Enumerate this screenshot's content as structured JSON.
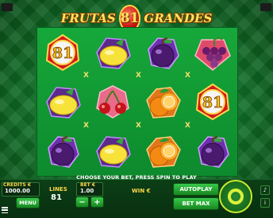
{
  "title": {
    "word_left": "FRUTAS",
    "badge": "81",
    "word_right": "GRANDES"
  },
  "reels": [
    [
      "81",
      "lemon",
      "plum"
    ],
    [
      "lemon",
      "cherries",
      "lemon"
    ],
    [
      "plum",
      "orange",
      "orange"
    ],
    [
      "grapes",
      "81",
      "plum"
    ]
  ],
  "line_marker": "X",
  "message": "CHOOSE YOUR BET, PRESS SPIN TO PLAY",
  "credit": {
    "label": "CREDITS €",
    "value": "1000.00"
  },
  "menu_label": "MENU",
  "lines": {
    "label": "LINES",
    "value": "81"
  },
  "bet": {
    "label": "BET €",
    "value": "1.00"
  },
  "win": {
    "label": "WIN €",
    "value": ""
  },
  "autoplay_label": "AUTOPLAY",
  "betmax_label": "BET MAX",
  "icons": {
    "minus": "minus-icon",
    "plus": "plus-icon",
    "spin": "spin-icon",
    "sound": "sound-icon",
    "info": "info-icon",
    "menu": "hamburger-icon"
  }
}
